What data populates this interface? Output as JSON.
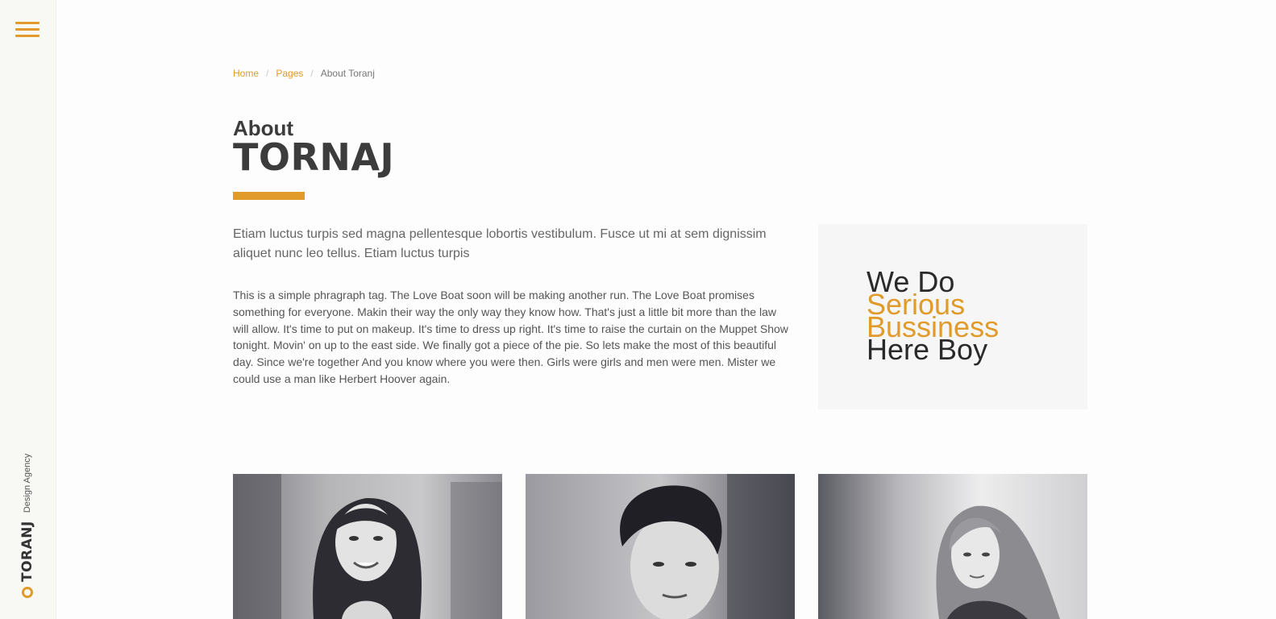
{
  "sidebar": {
    "brand_name": "TORANJ",
    "brand_tagline": "Design Agency"
  },
  "breadcrumb": {
    "items": [
      "Home",
      "Pages"
    ],
    "current": "About Toranj",
    "separator": "/"
  },
  "header": {
    "title_small": "About",
    "title_large": "TORNAJ"
  },
  "content": {
    "lead": "Etiam luctus turpis sed magna pellentesque lobortis vestibulum. Fusce ut mi at sem dignissim aliquet nunc leo tellus. Etiam luctus turpis",
    "paragraph": "This is a simple phragraph tag. The Love Boat soon will be making another run. The Love Boat promises something for everyone. Makin their way the only way they know how. That's just a little bit more than the law will allow. It's time to put on makeup. It's time to dress up right. It's time to raise the curtain on the Muppet Show tonight. Movin' on up to the east side. We finally got a piece of the pie. So lets make the most of this beautiful day. Since we're together And you know where you were then. Girls were girls and men were men. Mister we could use a man like Herbert Hoover again."
  },
  "quote": {
    "line1": "We Do",
    "line2": "Serious",
    "line3": "Bussiness",
    "line4": "Here Boy"
  },
  "colors": {
    "accent": "#e09b2a",
    "text_dark": "#3c3c3c",
    "sidebar_bg": "#f8f8f4",
    "quote_bg": "#f6f6f6"
  },
  "icons": {
    "menu": "hamburger-icon",
    "logo": "ring-logo-icon"
  }
}
